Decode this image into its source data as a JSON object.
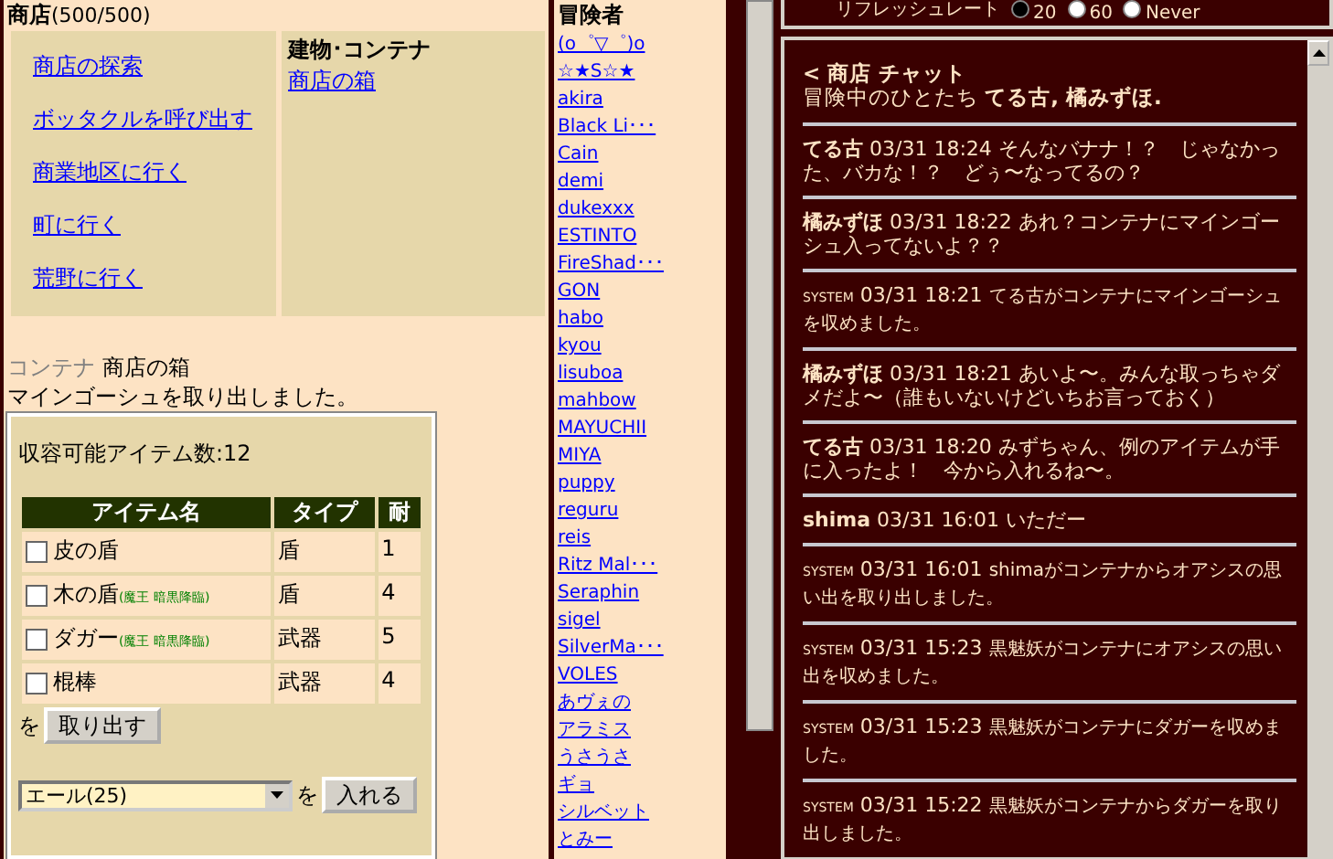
{
  "shop": {
    "title": "商店",
    "capacity": "(500/500)",
    "actions": [
      "商店の探索",
      "ボッタクルを呼び出す",
      "商業地区に行く",
      "町に行く",
      "荒野に行く"
    ],
    "buildings_heading": "建物･コンテナ",
    "buildings": [
      "商店の箱"
    ]
  },
  "container": {
    "label": "コンテナ",
    "name": "商店の箱",
    "message": "マインゴーシュを取り出しました。",
    "capacity": "収容可能アイテム数:12",
    "columns": [
      "アイテム名",
      "タイプ",
      "耐"
    ],
    "rows": [
      {
        "name": "皮の盾",
        "tag": "",
        "type": "盾",
        "durability": "1",
        "checked": false
      },
      {
        "name": "木の盾",
        "tag": "(魔王 暗黒降臨)",
        "type": "盾",
        "durability": "4",
        "checked": false
      },
      {
        "name": "ダガー",
        "tag": "(魔王 暗黒降臨)",
        "type": "武器",
        "durability": "5",
        "checked": false
      },
      {
        "name": "棍棒",
        "tag": "",
        "type": "武器",
        "durability": "4",
        "checked": false
      }
    ],
    "take_prefix": "を",
    "take_button": "取り出す",
    "select_value": "エール(25)",
    "put_prefix": "を",
    "put_button": "入れる"
  },
  "adventurers": {
    "heading": "冒険者",
    "names": [
      "(o゜▽゜)o",
      "☆★S☆★",
      "akira",
      "Black Li･･･",
      "Cain",
      "demi",
      "dukexxx",
      "ESTINTO",
      "FireShad･･･",
      "GON",
      "habo",
      "kyou",
      "lisuboa",
      "mahbow",
      "MAYUCHII",
      "MIYA",
      "puppy",
      "reguru",
      "reis",
      "Ritz Mal･･･",
      "Seraphin",
      "sigel",
      "SilverMa･･･",
      "VOLES",
      "あヴぇの",
      "アラミス",
      "うさうさ",
      "ギョ",
      "シルベット",
      "とみー"
    ]
  },
  "refresh": {
    "label": "リフレッシュレート",
    "options": [
      {
        "label": "20",
        "selected": true
      },
      {
        "label": "60",
        "selected": false
      },
      {
        "label": "Never",
        "selected": false
      }
    ]
  },
  "chat": {
    "back": "<",
    "title": "商店 チャット",
    "members_label": "冒険中のひとたち",
    "members": "てる古, 橘みずほ.",
    "messages": [
      {
        "kind": "user",
        "sender": "てる古",
        "time": "03/31 18:24",
        "text": "そんなバナナ！？　じゃなかった、バカな！？　どぅ〜なってるの？"
      },
      {
        "kind": "user",
        "sender": "橘みずほ",
        "time": "03/31 18:22",
        "text": "あれ？コンテナにマインゴーシュ入ってないよ？？"
      },
      {
        "kind": "system",
        "sender": "SYSTEM",
        "time": "03/31 18:21",
        "text": "てる古がコンテナにマインゴーシュを収めました。"
      },
      {
        "kind": "user",
        "sender": "橘みずほ",
        "time": "03/31 18:21",
        "text": "あいよ〜。みんな取っちゃダメだよ〜（誰もいないけどいちお言っておく）"
      },
      {
        "kind": "user",
        "sender": "てる古",
        "time": "03/31 18:20",
        "text": "みずちゃん、例のアイテムが手に入ったよ！　今から入れるね〜。"
      },
      {
        "kind": "user",
        "sender": "shima",
        "time": "03/31 16:01",
        "text": "いただー"
      },
      {
        "kind": "system",
        "sender": "SYSTEM",
        "time": "03/31 16:01",
        "text": "shimaがコンテナからオアシスの思い出を取り出しました。"
      },
      {
        "kind": "system",
        "sender": "SYSTEM",
        "time": "03/31 15:23",
        "text": "黒魅妖がコンテナにオアシスの思い出を収めました。"
      },
      {
        "kind": "system",
        "sender": "SYSTEM",
        "time": "03/31 15:23",
        "text": "黒魅妖がコンテナにダガーを収めました。"
      },
      {
        "kind": "system",
        "sender": "SYSTEM",
        "time": "03/31 15:22",
        "text": "黒魅妖がコンテナからダガーを取り出しました。"
      }
    ]
  }
}
